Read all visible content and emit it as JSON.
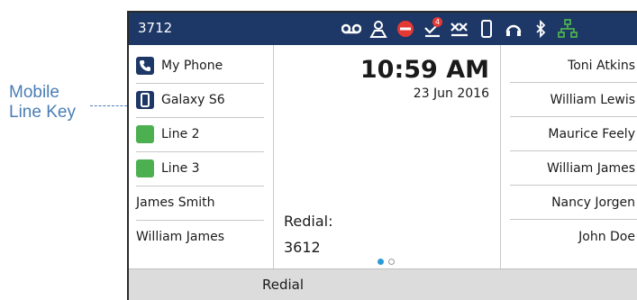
{
  "callout": {
    "line1": "Mobile",
    "line2": "Line Key"
  },
  "status_bar": {
    "extension": "3712",
    "voicemail_count": "4",
    "icons": [
      "voicemail-icon",
      "presence-icon",
      "dnd-icon",
      "missed-calls-icon",
      "call-forward-icon",
      "mobile-device-icon",
      "headset-icon",
      "bluetooth-icon",
      "network-icon"
    ],
    "colors": {
      "bar": "#1d3766",
      "dnd": "#e53935",
      "badge": "#e53935",
      "network": "#4caf50"
    }
  },
  "line_keys": [
    {
      "label": "My Phone",
      "icon": "phone-icon"
    },
    {
      "label": "Galaxy S6",
      "icon": "mobile-phone-icon"
    },
    {
      "label": "Line 2",
      "icon": "line-indicator-icon"
    },
    {
      "label": "Line 3",
      "icon": "line-indicator-icon"
    },
    {
      "label": "James Smith"
    },
    {
      "label": "William James"
    }
  ],
  "clock": {
    "time": "10:59 AM",
    "date": "23 Jun 2016"
  },
  "redial": {
    "label": "Redial:",
    "number": "3612"
  },
  "pager": {
    "pages": 2,
    "current": 1
  },
  "speed_dials": [
    "Toni Atkins",
    "William Lewis",
    "Maurice Feely",
    "William James",
    "Nancy Jorgen",
    "John Doe"
  ],
  "softkeys": {
    "redial": "Redial"
  }
}
